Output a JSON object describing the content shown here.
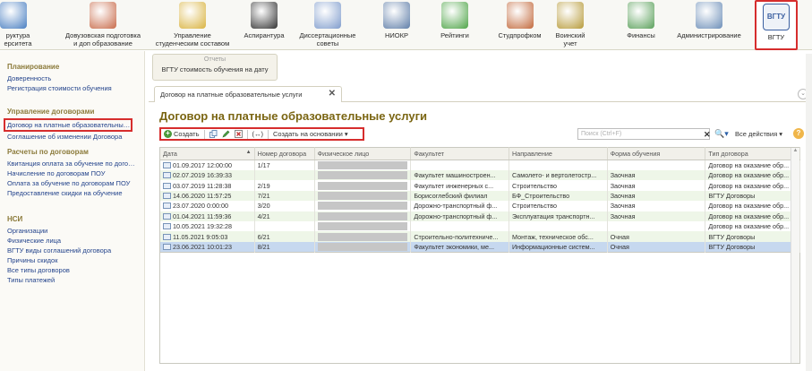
{
  "toolbar": {
    "items": [
      {
        "label": "руктура\nерситета",
        "icon": "structure-icon",
        "color": "#4a7fc1"
      },
      {
        "label": "Довузовская подготовка\nи доп образование",
        "icon": "people-icon",
        "color": "#c86b4a"
      },
      {
        "label": "Управление\nстуденческим составом",
        "icon": "certificate-icon",
        "color": "#d9b340"
      },
      {
        "label": "Аспирантура",
        "icon": "graduation-cap-icon",
        "color": "#333333"
      },
      {
        "label": "Диссертационные\nсоветы",
        "icon": "document-icon",
        "color": "#7f9ccc"
      },
      {
        "label": "НИОКР",
        "icon": "microscope-icon",
        "color": "#5f7ea8"
      },
      {
        "label": "Рейтинги",
        "icon": "pie-chart-icon",
        "color": "#4ea447"
      },
      {
        "label": "Студпрофком",
        "icon": "group-icon",
        "color": "#c2693c"
      },
      {
        "label": "Воинский\nучет",
        "icon": "shield-icon",
        "color": "#b79b3a"
      },
      {
        "label": "Финансы",
        "icon": "calculator-icon",
        "color": "#5aa05a"
      },
      {
        "label": "Администрирование",
        "icon": "gear-icon",
        "color": "#6d8fb8"
      },
      {
        "label": "ВГТУ",
        "icon": "vgtu-logo-icon",
        "color": "#3a5fa0",
        "logo_text": "ВГТУ"
      }
    ]
  },
  "sidebar": {
    "groups": [
      {
        "title": "Планирование",
        "items": [
          "Доверенность",
          "Регистрация стоимости обучения"
        ]
      },
      {
        "title": "Управление договорами",
        "items": [
          "Договор на платные образовательные услуги",
          "Соглашение об изменении Договора"
        ]
      },
      {
        "title": "Расчеты по договорам",
        "items": [
          "Квитанция оплата за обучение по договору",
          "Начисление по договорам ПОУ",
          "Оплата за обучение по договорам ПОУ",
          "Предоставление скидки на обучение"
        ]
      },
      {
        "title": "НСИ",
        "items": [
          "Организации",
          "Физические лица",
          "ВГТУ виды соглашений договора",
          "Причины скидок",
          "Все типы договоров",
          "Типы платежей"
        ]
      }
    ],
    "selected_item": "Договор на платные образовательные услуги"
  },
  "reports": {
    "title": "Отчеты",
    "item": "ВГТУ стоимость обучения на дату"
  },
  "tab": {
    "label": "Договор на платные образовательные услуги",
    "close": "✕"
  },
  "page_title": "Договор на платные образовательные услуги",
  "commands": {
    "create": "Создать",
    "create_based_on": "Создать на основании ▾",
    "plus": "+",
    "link_symbol": "(↔)"
  },
  "search": {
    "placeholder": "Поиск (Ctrl+F)",
    "clear": "✕",
    "search_icon": "🔍▾",
    "all_actions": "Все действия ▾",
    "help": "?"
  },
  "table": {
    "columns": [
      "Дата",
      "Номер договора",
      "Физическое лицо",
      "Факультет",
      "Направление",
      "Форма обучения",
      "Тип договора"
    ],
    "sort_indicator": "▲",
    "rows": [
      {
        "date": "01.09.2017 12:00:00",
        "num": "1/17",
        "person": "",
        "faculty": "",
        "direction": "",
        "form": "",
        "type": "Договор на оказание обр..."
      },
      {
        "date": "02.07.2019 16:39:33",
        "num": "",
        "person": "",
        "faculty": "Факультет машиностроен...",
        "direction": "Самолето- и вертолетостр...",
        "form": "Заочная",
        "type": "Договор на оказание обр..."
      },
      {
        "date": "03.07.2019 11:28:38",
        "num": "2/19",
        "person": "",
        "faculty": "Факультет инженерных с...",
        "direction": "Строительство",
        "form": "Заочная",
        "type": "Договор на оказание обр..."
      },
      {
        "date": "14.06.2020 11:57:25",
        "num": "7/21",
        "person": "",
        "faculty": "Борисоглебский филиал",
        "direction": "БФ_Строительство",
        "form": "Заочная",
        "type": "ВГТУ Договоры"
      },
      {
        "date": "23.07.2020 0:00:00",
        "num": "3/20",
        "person": "",
        "faculty": "Дорожно-транспортный ф...",
        "direction": "Строительство",
        "form": "Заочная",
        "type": "Договор на оказание обр..."
      },
      {
        "date": "01.04.2021 11:59:36",
        "num": "4/21",
        "person": "",
        "faculty": "Дорожно-транспортный ф...",
        "direction": "Эксплуатация транспортн...",
        "form": "Заочная",
        "type": "Договор на оказание обр..."
      },
      {
        "date": "10.05.2021 19:32:28",
        "num": "",
        "person": "",
        "faculty": "",
        "direction": "",
        "form": "",
        "type": "Договор на оказание обр..."
      },
      {
        "date": "11.05.2021 9:05:03",
        "num": "6/21",
        "person": "",
        "faculty": "Строительно-политехниче...",
        "direction": "Монтаж, техническое обс...",
        "form": "Очная",
        "type": "ВГТУ Договоры"
      },
      {
        "date": "23.06.2021 10:01:23",
        "num": "8/21",
        "person": "",
        "faculty": "Факультет экономики, ме...",
        "direction": "Информационные систем...",
        "form": "Очная",
        "type": "ВГТУ Договоры"
      }
    ],
    "selected_row": 8
  },
  "colors": {
    "accent_title": "#7a6512",
    "highlight": "#d62d2d",
    "link": "#24448c",
    "row_alt": "#eef6e8",
    "row_selected": "#c6d8ef"
  }
}
